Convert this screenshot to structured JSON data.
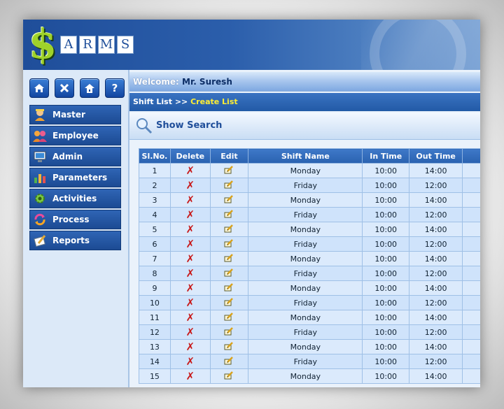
{
  "app": {
    "logo_symbol": "$",
    "logo_letters": [
      "A",
      "R",
      "M",
      "S"
    ]
  },
  "toolbar": {
    "icons": [
      "home-icon",
      "close-icon",
      "lock-icon",
      "help-icon"
    ],
    "help_label": "?"
  },
  "menu": [
    {
      "label": "Master",
      "icon": "master-icon"
    },
    {
      "label": "Employee",
      "icon": "employee-icon"
    },
    {
      "label": "Admin",
      "icon": "admin-icon"
    },
    {
      "label": "Parameters",
      "icon": "parameters-icon"
    },
    {
      "label": "Activities",
      "icon": "activities-icon"
    },
    {
      "label": "Process",
      "icon": "process-icon"
    },
    {
      "label": "Reports",
      "icon": "reports-icon"
    }
  ],
  "welcome": {
    "label": "Welcome:",
    "name": "Mr. Suresh"
  },
  "breadcrumb": {
    "parent": "Shift List",
    "separator": ">>",
    "current": "Create List"
  },
  "search": {
    "label": "Show Search"
  },
  "table": {
    "headers": [
      "Sl.No.",
      "Delete",
      "Edit",
      "Shift Name",
      "In Time",
      "Out Time"
    ],
    "rows": [
      {
        "no": "1",
        "name": "Monday",
        "in": "10:00",
        "out": "14:00"
      },
      {
        "no": "2",
        "name": "Friday",
        "in": "10:00",
        "out": "12:00"
      },
      {
        "no": "3",
        "name": "Monday",
        "in": "10:00",
        "out": "14:00"
      },
      {
        "no": "4",
        "name": "Friday",
        "in": "10:00",
        "out": "12:00"
      },
      {
        "no": "5",
        "name": "Monday",
        "in": "10:00",
        "out": "14:00"
      },
      {
        "no": "6",
        "name": "Friday",
        "in": "10:00",
        "out": "12:00"
      },
      {
        "no": "7",
        "name": "Monday",
        "in": "10:00",
        "out": "14:00"
      },
      {
        "no": "8",
        "name": "Friday",
        "in": "10:00",
        "out": "12:00"
      },
      {
        "no": "9",
        "name": "Monday",
        "in": "10:00",
        "out": "14:00"
      },
      {
        "no": "10",
        "name": "Friday",
        "in": "10:00",
        "out": "12:00"
      },
      {
        "no": "11",
        "name": "Monday",
        "in": "10:00",
        "out": "14:00"
      },
      {
        "no": "12",
        "name": "Friday",
        "in": "10:00",
        "out": "12:00"
      },
      {
        "no": "13",
        "name": "Monday",
        "in": "10:00",
        "out": "14:00"
      },
      {
        "no": "14",
        "name": "Friday",
        "in": "10:00",
        "out": "12:00"
      },
      {
        "no": "15",
        "name": "Monday",
        "in": "10:00",
        "out": "14:00"
      }
    ]
  },
  "colors": {
    "brand": "#1f4e9a",
    "accent": "#ffee33",
    "delete": "#c81818"
  }
}
